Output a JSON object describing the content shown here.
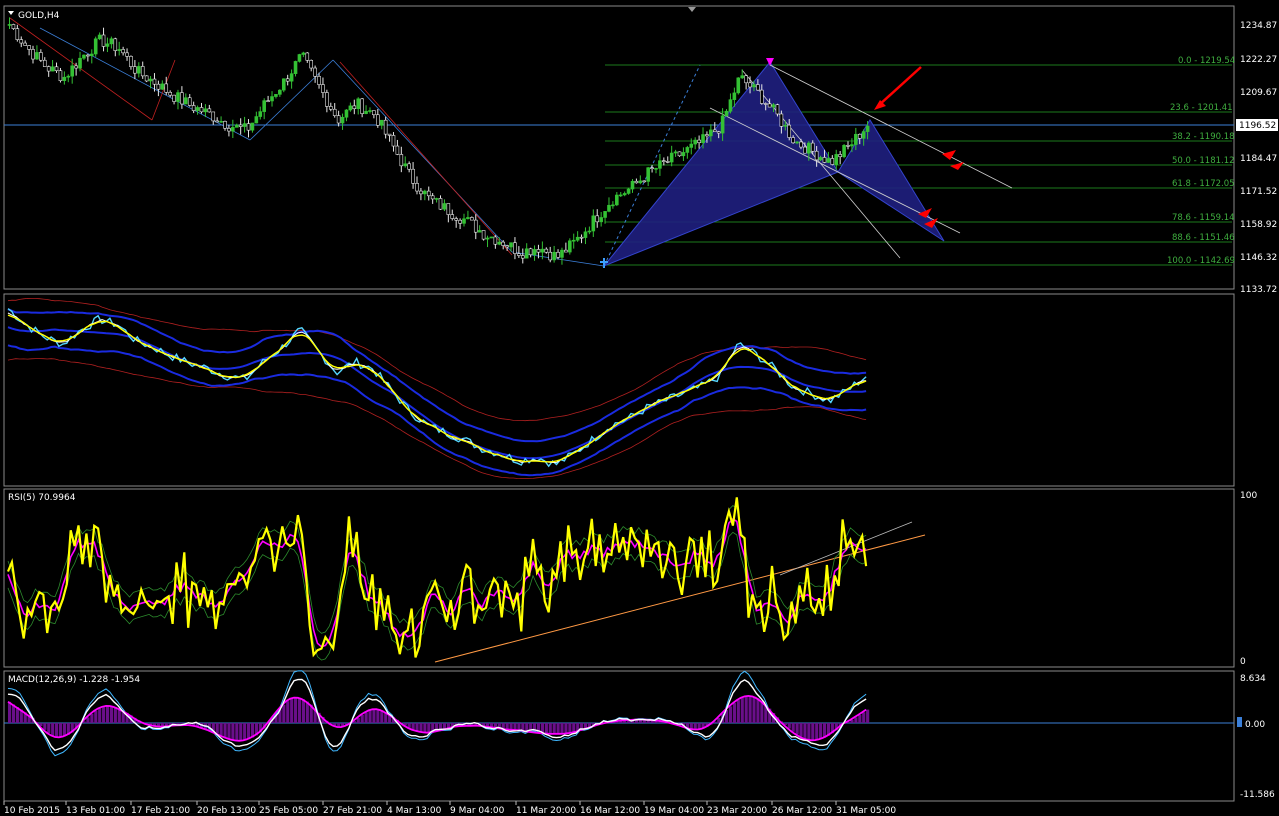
{
  "chart_data": [
    {
      "type": "candlestick",
      "title": "GOLD,H4",
      "yticks": [
        "1234.87",
        "1222.27",
        "1209.67",
        "1196.52",
        "1184.47",
        "1171.52",
        "1158.92",
        "1146.32",
        "1133.72"
      ],
      "current_price": "1196.52",
      "fib_levels": [
        {
          "label": "0.0 - 1219.54"
        },
        {
          "label": "23.6 - 1201.41"
        },
        {
          "label": "38.2 - 1190.18"
        },
        {
          "label": "50.0 - 1181.12"
        },
        {
          "label": "61.8 - 1172.05"
        },
        {
          "label": "78.6 - 1159.14"
        },
        {
          "label": "88.6 - 1151.46"
        },
        {
          "label": "100.0 - 1142.69"
        }
      ],
      "close_path": [
        1234,
        1225,
        1218,
        1214,
        1222,
        1228,
        1225,
        1216,
        1212,
        1207,
        1203,
        1200,
        1196,
        1194,
        1204,
        1212,
        1222,
        1210,
        1198,
        1204,
        1200,
        1188,
        1176,
        1168,
        1164,
        1160,
        1155,
        1152,
        1148,
        1150,
        1146,
        1152,
        1160,
        1168,
        1172,
        1178,
        1182,
        1186,
        1190,
        1196,
        1214,
        1208,
        1200,
        1190,
        1186,
        1182,
        1188,
        1196
      ]
    },
    {
      "type": "line",
      "title": "",
      "series": []
    },
    {
      "type": "line",
      "title": "RSI(5) 70.9964",
      "yticks": [
        "100",
        "0"
      ],
      "ylim": [
        0,
        100
      ]
    },
    {
      "type": "bar",
      "title": "MACD(12,26,9) -1.228 -1.954",
      "yticks": [
        "8.634",
        "0.00",
        "-11.586"
      ]
    }
  ],
  "xaxis": {
    "labels": [
      "10 Feb 2015",
      "13 Feb 01:00",
      "17 Feb 21:00",
      "20 Feb 13:00",
      "25 Feb 05:00",
      "27 Feb 21:00",
      "4 Mar 13:00",
      "9 Mar 04:00",
      "11 Mar 20:00",
      "16 Mar 12:00",
      "19 Mar 04:00",
      "23 Mar 20:00",
      "26 Mar 12:00",
      "31 Mar 05:00"
    ]
  },
  "colors": {
    "background": "#000000",
    "bull": "#34c134",
    "pattern_fill": "#1c1c7a",
    "fib": "#1d7a1d",
    "rsi": "#ffff00",
    "macd_hist": "#6a0f8a",
    "signal": "#ff00ff",
    "arrow": "#ff0000"
  }
}
